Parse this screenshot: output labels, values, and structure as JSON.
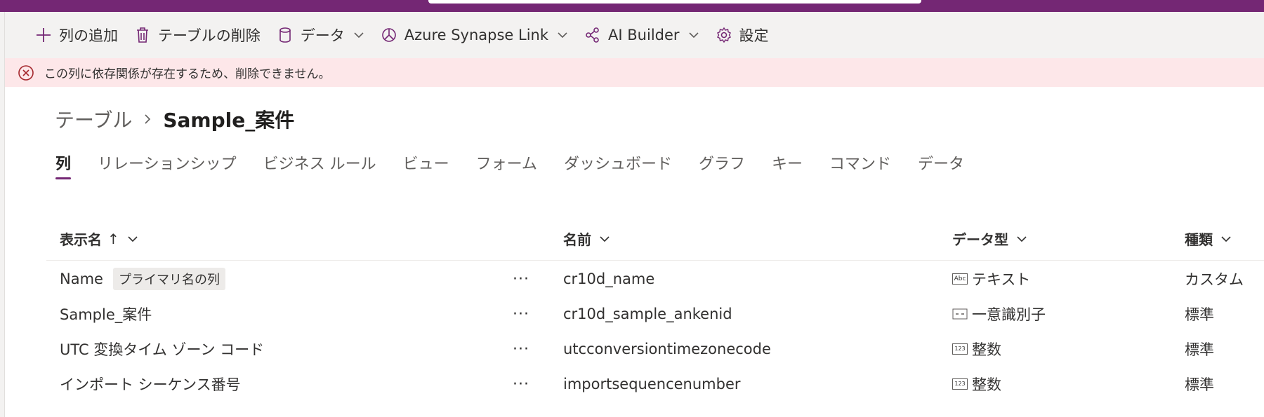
{
  "commandbar": {
    "add_column": "列の追加",
    "delete_table": "テーブルの削除",
    "data": "データ",
    "synapse": "Azure Synapse Link",
    "ai_builder": "AI Builder",
    "settings": "設定"
  },
  "message": {
    "text": "この列に依存関係が存在するため、削除できません。"
  },
  "breadcrumb": {
    "parent": "テーブル",
    "current": "Sample_案件"
  },
  "tabs": [
    "列",
    "リレーションシップ",
    "ビジネス ルール",
    "ビュー",
    "フォーム",
    "ダッシュボード",
    "グラフ",
    "キー",
    "コマンド",
    "データ"
  ],
  "table": {
    "headers": {
      "display_name": "表示名",
      "sort_indicator": "↑",
      "name": "名前",
      "data_type": "データ型",
      "kind": "種類"
    },
    "more_label": "···",
    "rows": [
      {
        "display_name": "Name",
        "badge": "プライマリ名の列",
        "name": "cr10d_name",
        "type_icon": "text-type-icon",
        "type_glyph": "Abc",
        "data_type": "テキスト",
        "kind": "カスタム"
      },
      {
        "display_name": "Sample_案件",
        "name": "cr10d_sample_ankenid",
        "type_icon": "unique-id-type-icon",
        "type_glyph": "",
        "data_type": "一意識別子",
        "kind": "標準"
      },
      {
        "display_name": "UTC 変換タイム ゾーン コード",
        "name": "utcconversiontimezonecode",
        "type_icon": "number-type-icon",
        "type_glyph": "123",
        "data_type": "整数",
        "kind": "標準"
      },
      {
        "display_name": "インポート シーケンス番号",
        "name": "importsequencenumber",
        "type_icon": "number-type-icon",
        "type_glyph": "123",
        "data_type": "整数",
        "kind": "標準"
      }
    ]
  },
  "colors": {
    "brand": "#742774",
    "error_bg": "#fde7e9",
    "error_icon": "#a4262c",
    "commandbar_bg": "#f3f2f1"
  }
}
